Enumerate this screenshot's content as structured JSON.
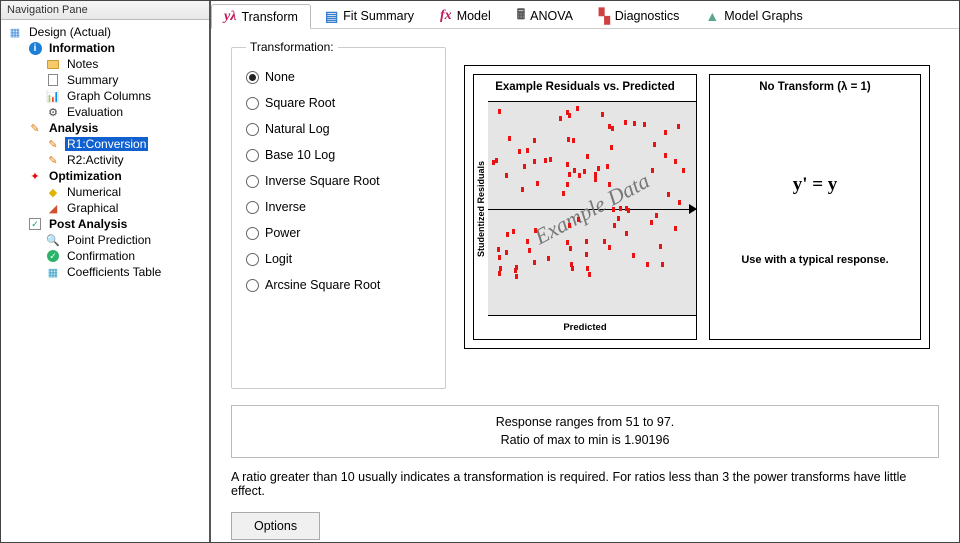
{
  "nav": {
    "title": "Navigation Pane",
    "root": "Design (Actual)",
    "information": "Information",
    "notes": "Notes",
    "summary": "Summary",
    "graph_columns": "Graph Columns",
    "evaluation": "Evaluation",
    "analysis": "Analysis",
    "r1": "R1:Conversion",
    "r2": "R2:Activity",
    "optimization": "Optimization",
    "numerical": "Numerical",
    "graphical": "Graphical",
    "post_analysis": "Post Analysis",
    "point_prediction": "Point Prediction",
    "confirmation": "Confirmation",
    "coeff_table": "Coefficients Table"
  },
  "tabs": {
    "transform": "Transform",
    "fit_summary": "Fit Summary",
    "model": "Model",
    "anova": "ANOVA",
    "diagnostics": "Diagnostics",
    "model_graphs": "Model Graphs",
    "icons": {
      "transform": "yλ",
      "fit": "▤",
      "model": "fx",
      "anova": "🖩",
      "diag": "▚",
      "mg": "▲"
    }
  },
  "transform_panel": {
    "legend": "Transformation:",
    "options": {
      "none": "None",
      "sqrt": "Square Root",
      "ln": "Natural Log",
      "log10": "Base 10 Log",
      "isqrt": "Inverse Square Root",
      "inv": "Inverse",
      "power": "Power",
      "logit": "Logit",
      "arcsine": "Arcsine Square Root"
    }
  },
  "plots": {
    "left_title": "Example Residuals vs. Predicted",
    "left_ylabel": "Studentized Residuals",
    "left_xlabel": "Predicted",
    "watermark": "Example Data",
    "right_title": "No Transform (λ = 1)",
    "right_formula": "y' = y",
    "right_caption": "Use with a typical response."
  },
  "summary": {
    "line1": "Response ranges from 51 to 97.",
    "line2": "Ratio of max to min is 1.90196"
  },
  "note": "A ratio greater than 10 usually indicates a transformation is required. For ratios less than 3 the power transforms have little effect.",
  "buttons": {
    "options": "Options"
  }
}
